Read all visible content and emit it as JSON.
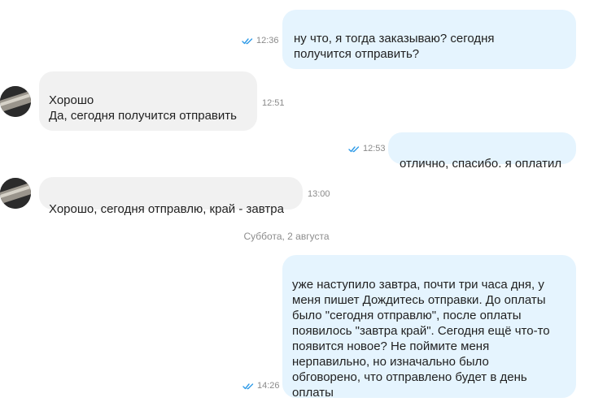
{
  "messages": [
    {
      "direction": "outgoing",
      "text": "ну что, я тогда заказываю? сегодня\nполучится отправить?",
      "time": "12:36",
      "status": "read"
    },
    {
      "direction": "incoming",
      "text": "Хорошо\nДа, сегодня получится отправить",
      "time": "12:51"
    },
    {
      "direction": "outgoing",
      "text": "отлично, спасибо. я оплатил",
      "time": "12:53",
      "status": "read"
    },
    {
      "direction": "incoming",
      "text": "Хорошо, сегодня отправлю, край - завтра",
      "time": "13:00"
    },
    {
      "direction": "outgoing",
      "text": "уже наступило завтра, почти три часа дня, у\nменя пишет Дождитесь отправки. До оплаты\nбыло \"сегодня отправлю\", после оплаты\nпоявилось \"завтра край\". Сегодня ещё что-то\nпоявится новое? Не поймите меня\nнерпавильно, но изначально было\nобговорено, что отправлено будет в день\nоплаты",
      "time": "14:26",
      "status": "read"
    }
  ],
  "date_separator": "Суббота, 2 августа",
  "colors": {
    "outgoing_bubble": "#e5f4fe",
    "incoming_bubble": "#f1f1f1",
    "read_ticks": "#2f9be8",
    "meta_text": "#8a8a8a"
  },
  "icons": {
    "read_status": "double-check-icon",
    "avatar": "contact-avatar"
  }
}
